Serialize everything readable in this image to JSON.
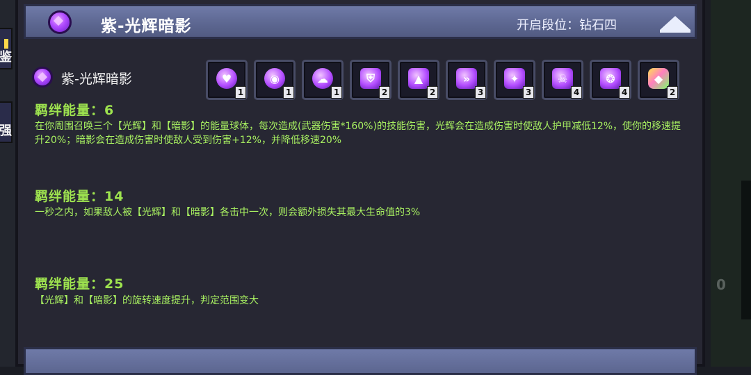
{
  "side_tabs": [
    {
      "label": "鉴"
    },
    {
      "label": "强"
    }
  ],
  "header": {
    "title": "紫-光辉暗影",
    "rank_label": "开启段位：钻石四"
  },
  "set": {
    "name": "紫-光辉暗影",
    "slots": [
      {
        "icon": "heart-icon",
        "glyph": "♥",
        "count": "1"
      },
      {
        "icon": "eye-icon",
        "glyph": "◉",
        "count": "1"
      },
      {
        "icon": "cloud-icon",
        "glyph": "☁",
        "count": "1"
      },
      {
        "icon": "shield-icon",
        "glyph": "⛨",
        "count": "2"
      },
      {
        "icon": "mountain-icon",
        "glyph": "▲",
        "count": "2"
      },
      {
        "icon": "wing-icon",
        "glyph": "»",
        "count": "3"
      },
      {
        "icon": "orb-icon",
        "glyph": "✦",
        "count": "3"
      },
      {
        "icon": "skull-icon",
        "glyph": "☠",
        "count": "4"
      },
      {
        "icon": "vortex-icon",
        "glyph": "❂",
        "count": "4"
      },
      {
        "icon": "crystal-icon",
        "glyph": "◆",
        "count": "2"
      }
    ]
  },
  "tiers": [
    {
      "heading": "羁绊能量：6",
      "description": "在你周围召唤三个【光辉】和【暗影】的能量球体，每次造成(武器伤害*160%)的技能伤害，光辉会在造成伤害时使敌人护甲减低12%，使你的移速提升20%；暗影会在造成伤害时使敌人受到伤害+12%，并降低移速20%"
    },
    {
      "heading": "羁绊能量：14",
      "description": "一秒之内，如果敌人被【光辉】和【暗影】各击中一次，则会额外损失其最大生命值的3%"
    },
    {
      "heading": "羁绊能量：25",
      "description": "【光辉】和【暗影】的旋转速度提升，判定范围变大"
    }
  ],
  "right_panel_text": "0",
  "colors": {
    "accent_green": "#a8f061",
    "header_blue": "#5c6690",
    "gem_purple": "#b04bff"
  }
}
